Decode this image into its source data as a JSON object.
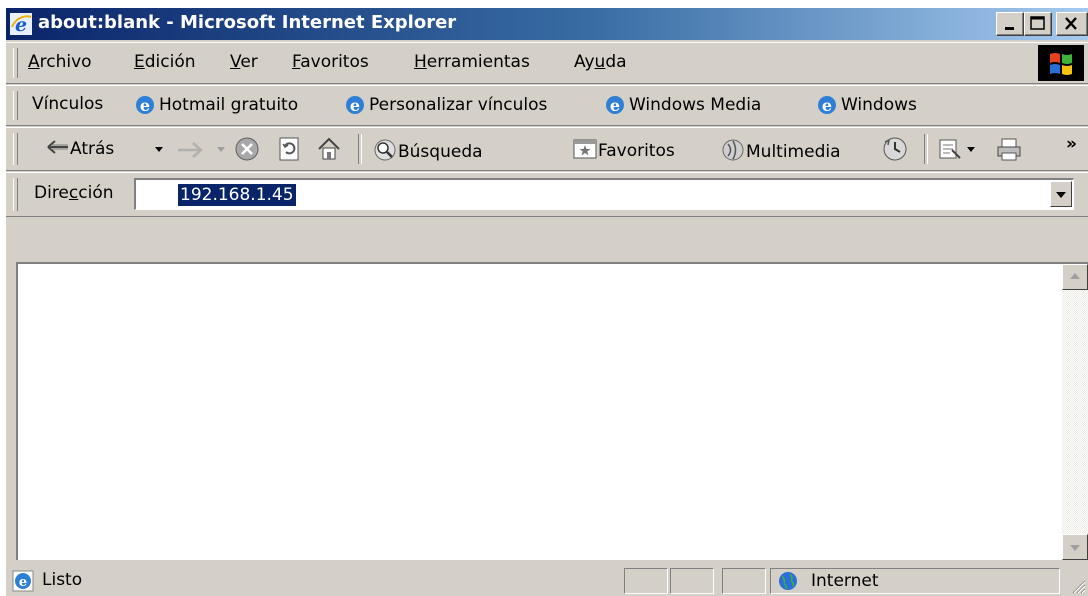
{
  "window": {
    "title": "about:blank - Microsoft Internet Explorer"
  },
  "menu": {
    "items": [
      {
        "accel": "A",
        "rest": "rchivo"
      },
      {
        "accel": "E",
        "rest": "dición"
      },
      {
        "accel": "V",
        "rest": "er"
      },
      {
        "accel": "F",
        "rest": "avoritos"
      },
      {
        "accel": "H",
        "rest": "erramientas"
      },
      {
        "pre": "Ay",
        "accel": "u",
        "rest": "da"
      }
    ]
  },
  "links": {
    "label": "Vínculos",
    "items": [
      "Hotmail gratuito",
      "Personalizar vínculos",
      "Windows Media",
      "Windows"
    ]
  },
  "toolbar": {
    "back": "Atrás",
    "search": "Búsqueda",
    "favorites": "Favoritos",
    "media": "Multimedia",
    "overflow": "»"
  },
  "address": {
    "label_pre": "Dire",
    "label_accel": "c",
    "label_post": "ción",
    "value": "192.168.1.45"
  },
  "status": {
    "text": "Listo",
    "zone": "Internet"
  }
}
